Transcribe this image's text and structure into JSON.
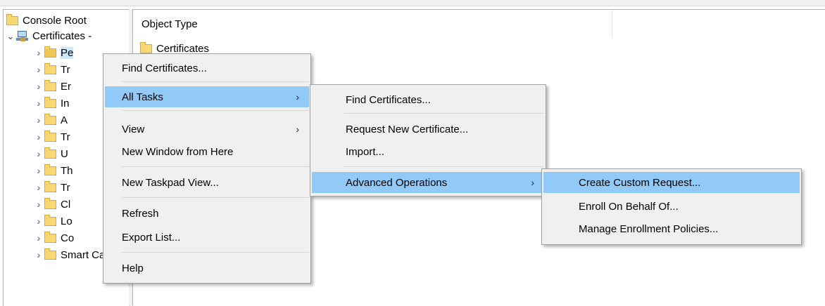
{
  "tree": {
    "root": "Console Root",
    "certificates": "Certificates -",
    "children": [
      "Pe",
      "Tr",
      "Er",
      "In",
      "A",
      "Tr",
      "U",
      "Th",
      "Tr",
      "Cl",
      "Lo",
      "Co",
      "Smart Car"
    ]
  },
  "list": {
    "column_header": "Object Type",
    "rows": [
      "Certificates"
    ]
  },
  "context_menu": {
    "items": [
      "Find Certificates...",
      "All Tasks",
      "View",
      "New Window from Here",
      "New Taskpad View...",
      "Refresh",
      "Export List...",
      "Help"
    ]
  },
  "all_tasks_menu": {
    "items": [
      "Find Certificates...",
      "Request New Certificate...",
      "Import...",
      "Advanced Operations"
    ]
  },
  "advanced_menu": {
    "items": [
      "Create Custom Request...",
      "Enroll On Behalf Of...",
      "Manage Enrollment Policies..."
    ]
  },
  "submenu_arrow": "›",
  "icons": {
    "expand": "chevron-right-icon",
    "collapse": "chevron-down-icon",
    "folder": "folder-icon",
    "computer": "computer-icon"
  },
  "colors": {
    "highlight": "#91c9f7",
    "menu_bg": "#f0f0f0",
    "folder": "#f8d775"
  }
}
